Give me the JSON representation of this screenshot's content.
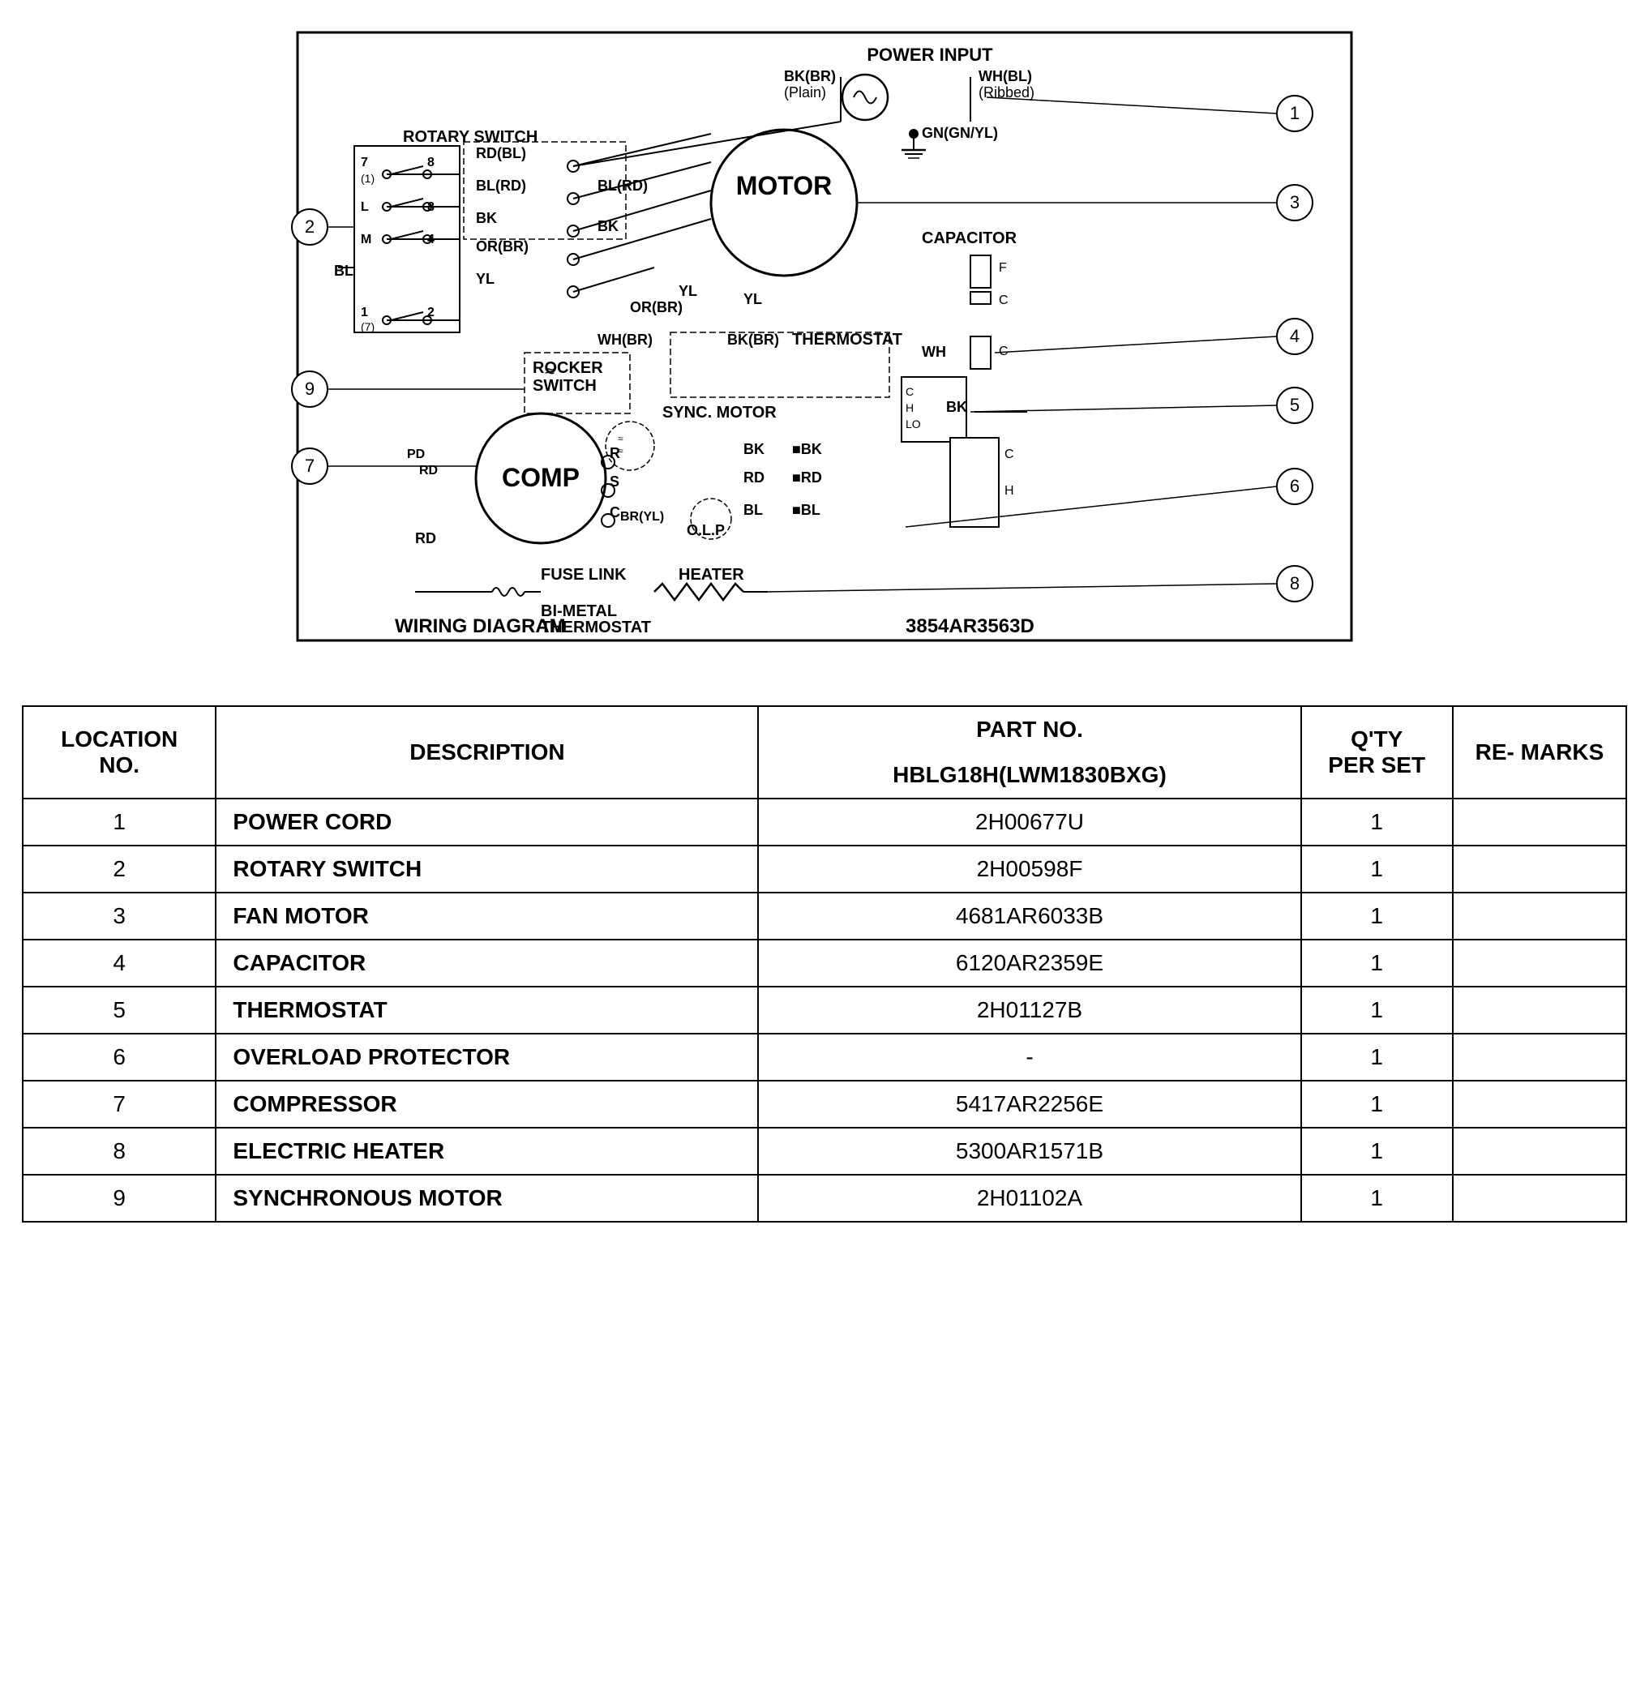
{
  "diagram": {
    "title": "WIRING DIAGRAM",
    "partNumber": "3854AR3563D",
    "bimetalLabel": "BI-METAL\nTHERMOSTAT",
    "fuseLinkLabel": "FUSE LINK",
    "heaterLabel": "HEATER",
    "powerInputLabel": "POWER INPUT",
    "motorLabel": "MOTOR",
    "compLabel": "COMP",
    "capacitorLabel": "CAPACITOR",
    "thermostatLabel": "THERMOSTAT",
    "rotarySwitchLabel": "ROTARY SWITCH",
    "rockerSwitchLabel": "ROCKER\nSWITCH",
    "syncMotorLabel": "SYNC. MOTOR",
    "olpLabel": "O.L.P",
    "circleNumbers": [
      "1",
      "2",
      "3",
      "4",
      "5",
      "6",
      "7",
      "8",
      "9"
    ]
  },
  "table": {
    "headers": {
      "locationNo": "LOCATION\nNO.",
      "description": "DESCRIPTION",
      "partNo": "PART NO.",
      "modelNo": "HBLG18H(LWM1830BXG)",
      "qtyPerSet": "Q'TY\nPER SET",
      "remarks": "RE-\nMARKS"
    },
    "rows": [
      {
        "location": "1",
        "description": "POWER CORD",
        "partNo": "2H00677U",
        "qty": "1",
        "remarks": ""
      },
      {
        "location": "2",
        "description": "ROTARY SWITCH",
        "partNo": "2H00598F",
        "qty": "1",
        "remarks": ""
      },
      {
        "location": "3",
        "description": "FAN MOTOR",
        "partNo": "4681AR6033B",
        "qty": "1",
        "remarks": ""
      },
      {
        "location": "4",
        "description": "CAPACITOR",
        "partNo": "6120AR2359E",
        "qty": "1",
        "remarks": ""
      },
      {
        "location": "5",
        "description": "THERMOSTAT",
        "partNo": "2H01127B",
        "qty": "1",
        "remarks": ""
      },
      {
        "location": "6",
        "description": "OVERLOAD PROTECTOR",
        "partNo": "-",
        "qty": "1",
        "remarks": ""
      },
      {
        "location": "7",
        "description": "COMPRESSOR",
        "partNo": "5417AR2256E",
        "qty": "1",
        "remarks": ""
      },
      {
        "location": "8",
        "description": "ELECTRIC HEATER",
        "partNo": "5300AR1571B",
        "qty": "1",
        "remarks": ""
      },
      {
        "location": "9",
        "description": "SYNCHRONOUS MOTOR",
        "partNo": "2H01102A",
        "qty": "1",
        "remarks": ""
      }
    ]
  }
}
